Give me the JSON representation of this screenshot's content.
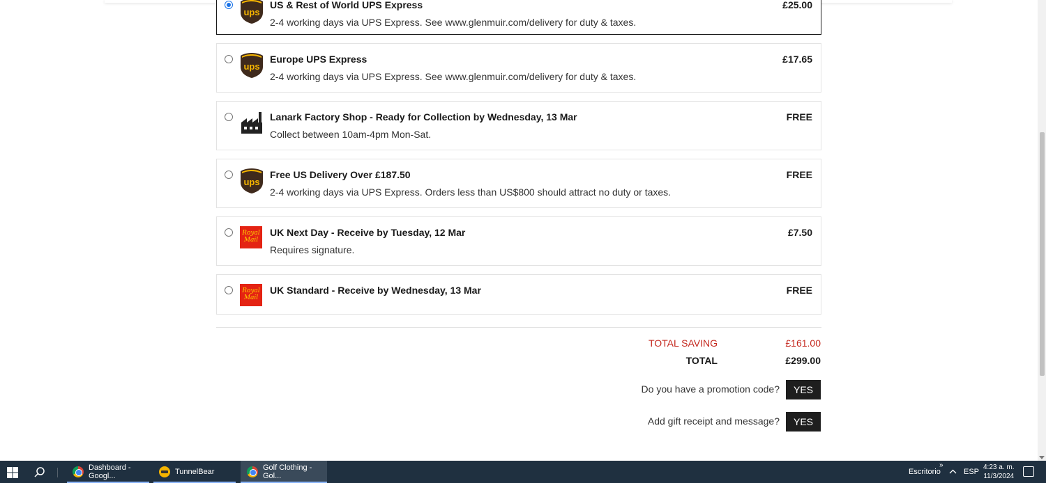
{
  "shipping_options": [
    {
      "title": "US & Rest of World UPS Express",
      "description": "2-4 working days via UPS Express. See www.glenmuir.com/delivery for duty & taxes.",
      "price": "£25.00",
      "logo": "ups-icon",
      "selected": true
    },
    {
      "title": "Europe UPS Express",
      "description": "2-4 working days via UPS Express. See www.glenmuir.com/delivery for duty & taxes.",
      "price": "£17.65",
      "logo": "ups-icon",
      "selected": false
    },
    {
      "title": "Lanark Factory Shop - Ready for Collection by Wednesday, 13 Mar",
      "description": "Collect between 10am-4pm Mon-Sat.",
      "price": "FREE",
      "logo": "factory-icon",
      "selected": false
    },
    {
      "title": "Free US Delivery Over £187.50",
      "description": "2-4 working days via UPS Express. Orders less than US$800 should attract no duty or taxes.",
      "price": "FREE",
      "logo": "ups-icon",
      "selected": false
    },
    {
      "title": "UK Next Day - Receive by Tuesday, 12 Mar",
      "description": "Requires signature.",
      "price": "£7.50",
      "logo": "royal-mail-icon",
      "selected": false
    },
    {
      "title": "UK Standard - Receive by Wednesday, 13 Mar",
      "description": "",
      "price": "FREE",
      "logo": "royal-mail-icon",
      "selected": false
    }
  ],
  "royal_mail_logo_text": "Royal Mail",
  "totals": {
    "saving_label": "TOTAL SAVING",
    "saving_value": "£161.00",
    "total_label": "TOTAL",
    "total_value": "£299.00"
  },
  "promo": {
    "question": "Do you have a promotion code?",
    "button": "YES"
  },
  "gift": {
    "question": "Add gift receipt and message?",
    "button": "YES"
  },
  "taskbar": {
    "apps": [
      {
        "label": "Dashboard - Googl...",
        "icon": "chrome-icon",
        "active": false
      },
      {
        "label": "TunnelBear",
        "icon": "tunnelbear-icon",
        "active": false
      },
      {
        "label": "Golf Clothing - Gol...",
        "icon": "chrome-icon",
        "active": true
      }
    ],
    "desktop_label": "Escritorio",
    "language": "ESP",
    "time": "4:23 a. m.",
    "date": "11/3/2024"
  },
  "colors": {
    "saving": "#c4271d",
    "button_bg": "#1e1e1e",
    "ups_brown": "#3f2a1c",
    "ups_gold": "#f7b600",
    "royal_mail_red": "#e42313",
    "taskbar": "#1f3040"
  }
}
